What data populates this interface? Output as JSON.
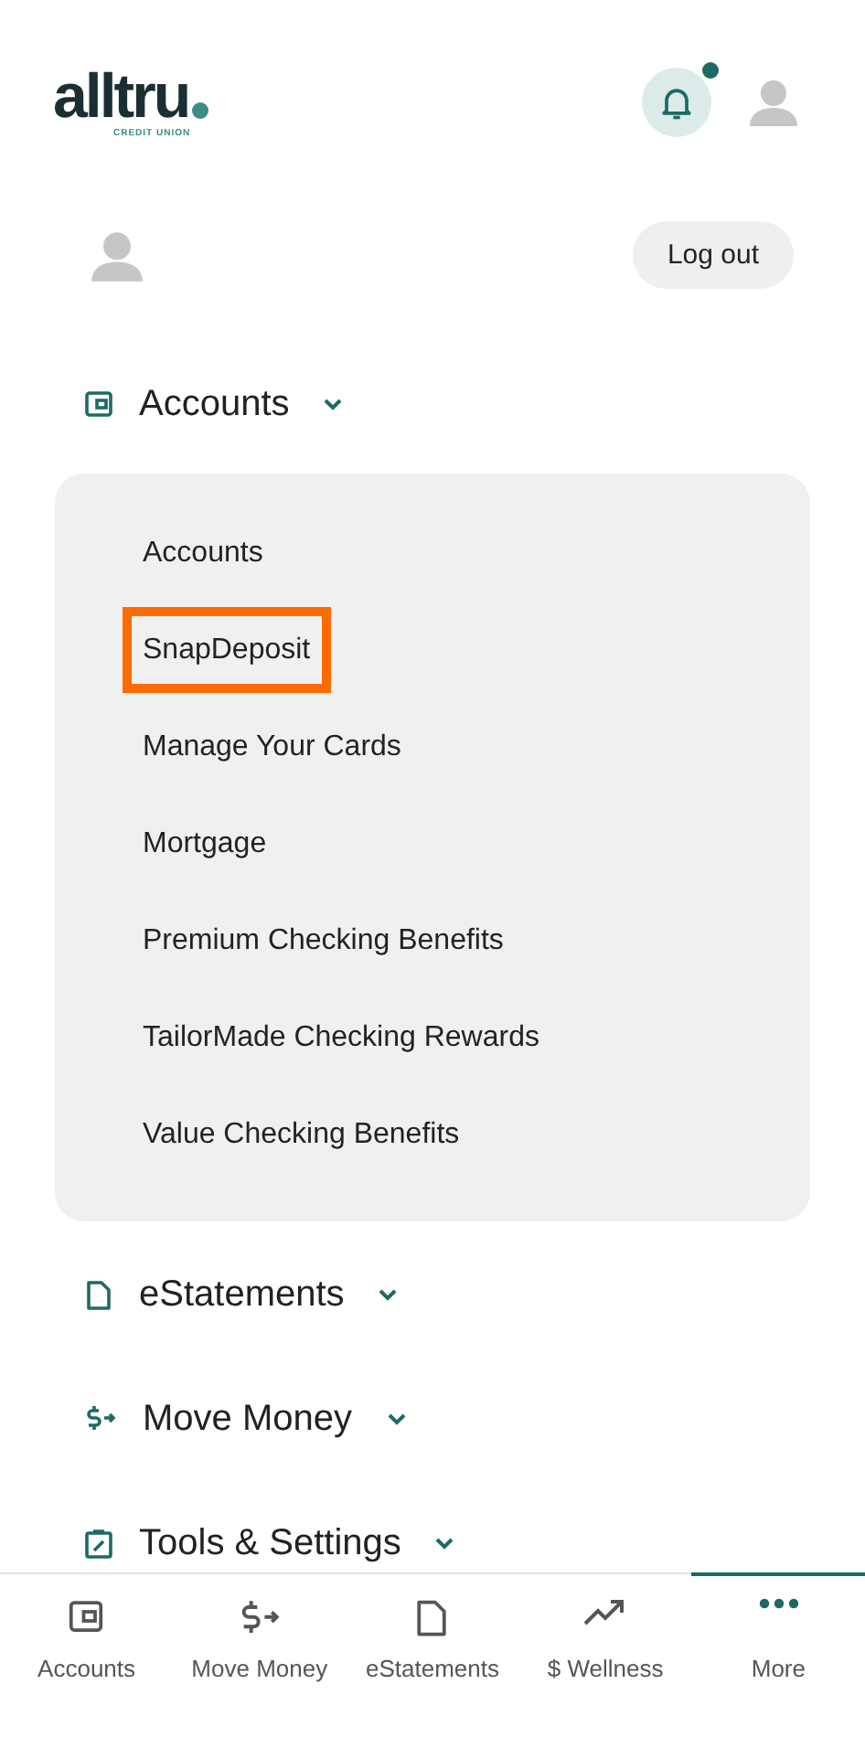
{
  "header": {
    "logo": {
      "name": "alltru",
      "tagline": "CREDIT UNION"
    },
    "notification_dot": true
  },
  "profile": {
    "logout_button": "Log out"
  },
  "menu": [
    {
      "kind": "wallet",
      "label": "Accounts",
      "items": [
        {
          "label": "Accounts",
          "highlighted": false
        },
        {
          "label": "SnapDeposit",
          "highlighted": true
        },
        {
          "label": "Manage Your Cards",
          "highlighted": false
        },
        {
          "label": "Mortgage",
          "highlighted": false
        },
        {
          "label": "Premium Checking Benefits",
          "highlighted": false
        },
        {
          "label": "TailorMade Checking Rewards",
          "highlighted": false
        },
        {
          "label": "Value Checking Benefits",
          "highlighted": false
        }
      ]
    },
    {
      "kind": "document",
      "label": "eStatements"
    },
    {
      "kind": "money",
      "label": "Move Money"
    },
    {
      "kind": "tools",
      "label": "Tools & Settings"
    }
  ],
  "tab_bar": [
    {
      "kind": "wallet",
      "label": "Accounts",
      "selected": false
    },
    {
      "kind": "money",
      "label": "Move Money",
      "selected": false
    },
    {
      "kind": "document",
      "label": "eStatements",
      "selected": false
    },
    {
      "kind": "trend",
      "label": "$ Wellness",
      "selected": false
    },
    {
      "kind": "more",
      "label": "More",
      "selected": true
    }
  ]
}
